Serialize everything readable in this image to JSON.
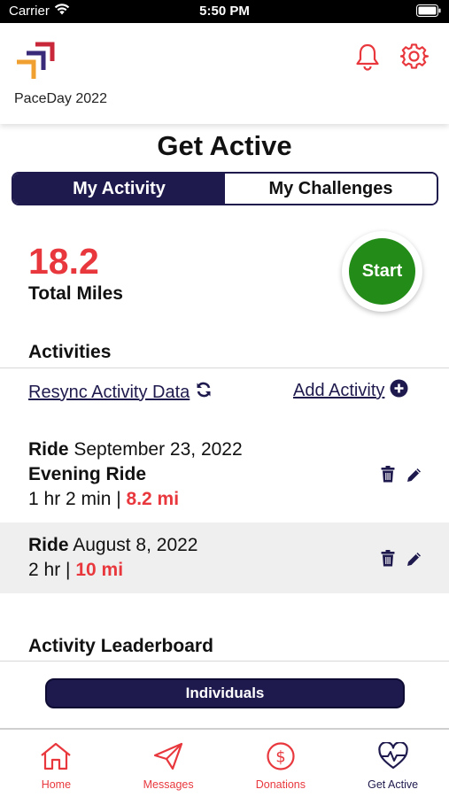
{
  "status_bar": {
    "carrier": "Carrier",
    "time": "5:50 PM"
  },
  "header": {
    "app_name": "PaceDay 2022"
  },
  "page_title": "Get Active",
  "tabs": [
    {
      "label": "My Activity",
      "active": true
    },
    {
      "label": "My Challenges",
      "active": false
    }
  ],
  "summary": {
    "total_miles": "18.2",
    "total_label": "Total Miles",
    "start_label": "Start"
  },
  "activities_section": {
    "title": "Activities",
    "resync_label": "Resync Activity Data",
    "add_label": "Add Activity"
  },
  "activities": [
    {
      "type": "Ride",
      "date": "September 23, 2022",
      "name": "Evening Ride",
      "duration": "1 hr 2 min",
      "separator": "|",
      "distance": "8.2 mi"
    },
    {
      "type": "Ride",
      "date": "August 8, 2022",
      "duration": "2 hr",
      "separator": "|",
      "distance": "10 mi"
    }
  ],
  "leaderboard": {
    "title": "Activity Leaderboard",
    "individuals_label": "Individuals"
  },
  "tab_bar": [
    {
      "label": "Home",
      "icon": "home-icon"
    },
    {
      "label": "Messages",
      "icon": "paper-plane-icon"
    },
    {
      "label": "Donations",
      "icon": "dollar-circle-icon"
    },
    {
      "label": "Get Active",
      "icon": "heart-pulse-icon",
      "active": true
    }
  ],
  "colors": {
    "navy": "#1e1a4d",
    "red": "#e8383d",
    "green": "#238b17",
    "logo_orange": "#f0a030",
    "logo_purple": "#3a2a7a",
    "logo_red": "#c8283a"
  }
}
